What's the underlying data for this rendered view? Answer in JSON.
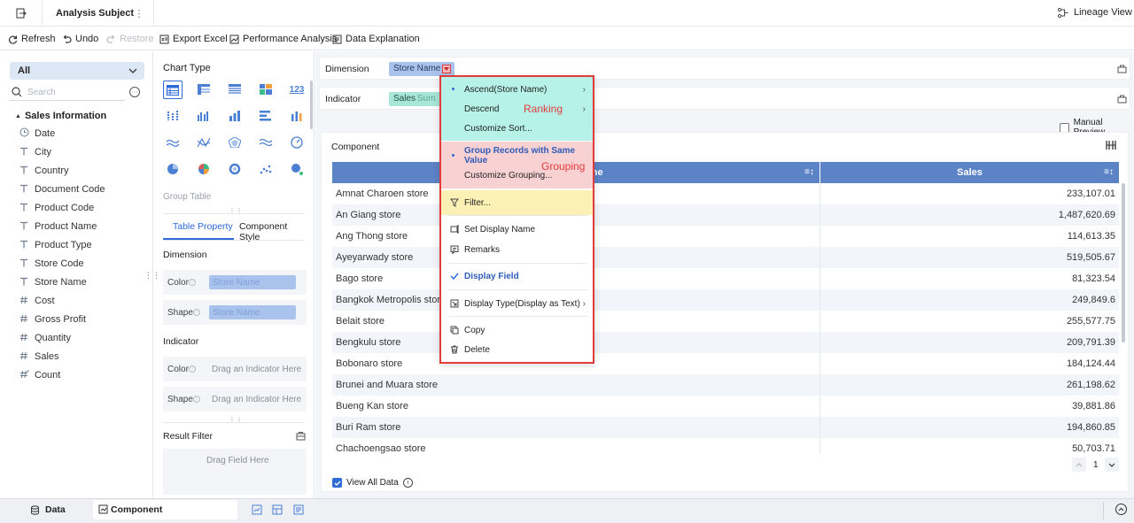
{
  "header": {
    "title": "Analysis Subject",
    "lineage_label": "Lineage View"
  },
  "toolbar": {
    "refresh": "Refresh",
    "undo": "Undo",
    "restore": "Restore",
    "export_excel": "Export Excel",
    "performance": "Performance Analysis",
    "explanation": "Data Explanation"
  },
  "left": {
    "scope_select": "All",
    "search_placeholder": "Search",
    "group_title": "Sales Information",
    "fields": [
      {
        "name": "Date",
        "icon": "clock-icon"
      },
      {
        "name": "City",
        "icon": "text-type-icon"
      },
      {
        "name": "Country",
        "icon": "text-type-icon"
      },
      {
        "name": "Document Code",
        "icon": "text-type-icon"
      },
      {
        "name": "Product Code",
        "icon": "text-type-icon"
      },
      {
        "name": "Product Name",
        "icon": "text-type-icon"
      },
      {
        "name": "Product Type",
        "icon": "text-type-icon"
      },
      {
        "name": "Store Code",
        "icon": "text-type-icon"
      },
      {
        "name": "Store Name",
        "icon": "text-type-icon"
      },
      {
        "name": "Cost",
        "icon": "number-type-icon"
      },
      {
        "name": "Gross Profit",
        "icon": "number-type-icon"
      },
      {
        "name": "Quantity",
        "icon": "number-type-icon"
      },
      {
        "name": "Sales",
        "icon": "number-type-icon"
      },
      {
        "name": "Count",
        "icon": "count-type-icon"
      }
    ]
  },
  "middle": {
    "chart_type_title": "Chart Type",
    "selected_chart_label": "Group Table",
    "tabs": [
      "Table Property",
      "Component Style"
    ],
    "dimension_title": "Dimension",
    "color_label": "Color",
    "shape_label": "Shape",
    "dimension_color_value": "Store Name",
    "dimension_shape_value": "Store Name",
    "indicator_title": "Indicator",
    "indicator_drop_hint": "Drag an Indicator Here",
    "result_filter_title": "Result Filter",
    "field_drop_hint": "Drag Field Here"
  },
  "right": {
    "dimension_label": "Dimension",
    "dimension_chip": "Store Name",
    "indicator_label": "Indicator",
    "indicator_chip": "Sales",
    "indicator_agg": "Sum",
    "manual_preview": "Manual Preview",
    "component_label": "Component",
    "table_headers": [
      "Store Name",
      "Sales"
    ],
    "rows": [
      [
        "Amnat Charoen store",
        "233,107.01"
      ],
      [
        "An Giang store",
        "1,487,620.69"
      ],
      [
        "Ang Thong store",
        "114,613.35"
      ],
      [
        "Ayeyarwady store",
        "519,505.67"
      ],
      [
        "Bago store",
        "81,323.54"
      ],
      [
        "Bangkok Metropolis store",
        "249,849.6"
      ],
      [
        "Belait store",
        "255,577.75"
      ],
      [
        "Bengkulu store",
        "209,791.39"
      ],
      [
        "Bobonaro store",
        "184,124.44"
      ],
      [
        "Brunei and Muara store",
        "261,198.62"
      ],
      [
        "Bueng Kan store",
        "39,881.86"
      ],
      [
        "Buri Ram store",
        "194,860.85"
      ],
      [
        "Chachoengsao store",
        "50,703.71"
      ]
    ],
    "page_number": "1",
    "view_all_label": "View All Data"
  },
  "menu": {
    "ascend": "Ascend(Store Name)",
    "descend": "Descend",
    "customize_sort": "Customize Sort...",
    "ranking_note": "Ranking",
    "group_same": "Group Records with Same Value",
    "customize_grouping": "Customize Grouping...",
    "grouping_note": "Grouping",
    "filter": "Filter...",
    "set_display_name": "Set Display Name",
    "remarks": "Remarks",
    "display_field": "Display Field",
    "display_type": "Display Type(Display as Text)",
    "copy": "Copy",
    "delete": "Delete"
  },
  "bottom": {
    "data_tab": "Data",
    "component_tab": "Component"
  },
  "colors": {
    "accent": "#2e6bd6",
    "table_header": "#5b83c6",
    "ranking_bg": "#b6f2e7",
    "grouping_bg": "#f8d1d3",
    "filter_bg": "#fbf1b5",
    "menu_border": "#e23b3b",
    "note_text": "#e23b3b"
  }
}
